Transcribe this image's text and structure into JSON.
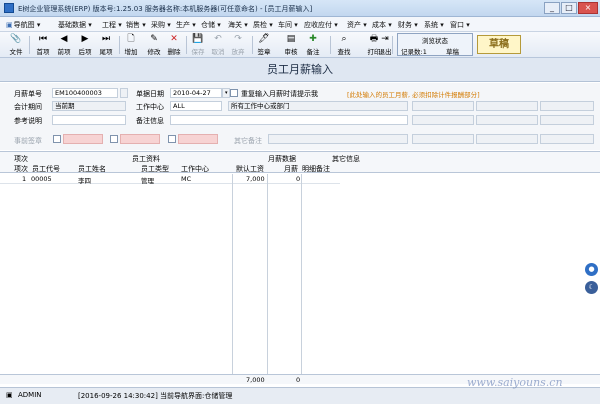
{
  "window": {
    "title": "E树企业管理系统(ERP) 版本号:1.25.03 服务器名称:本机服务器(可任意命名) - [员工月薪输入]",
    "controls": [
      "_",
      "□",
      "×"
    ]
  },
  "menu": [
    {
      "icon": "▣",
      "label": "导航图 ▾"
    },
    {
      "label": "基础数据 ▾"
    },
    {
      "label": "工程 ▾"
    },
    {
      "label": "销售 ▾"
    },
    {
      "label": "采购 ▾"
    },
    {
      "label": "生产 ▾"
    },
    {
      "label": "仓储 ▾"
    },
    {
      "label": "海关 ▾"
    },
    {
      "label": "质检 ▾"
    },
    {
      "label": "车间 ▾"
    },
    {
      "label": "应收应付 ▾"
    },
    {
      "label": "资产 ▾"
    },
    {
      "label": "成本 ▾"
    },
    {
      "label": "财务 ▾"
    },
    {
      "label": "系统 ▾"
    },
    {
      "label": "窗口 ▾"
    }
  ],
  "toolbar": {
    "file": "文件",
    "first": "首项",
    "prev": "前项",
    "next": "后项",
    "last": "尾项",
    "add": "增加",
    "edit": "修改",
    "delete": "删除",
    "save": "保存",
    "undo": "取消",
    "abandon": "放弃",
    "sign": "签章",
    "review": "审核",
    "note": "备注",
    "find": "查找",
    "print": "打印",
    "exit": "退出"
  },
  "browse_status": {
    "caption": "浏览状态",
    "record_count": "记录数:1",
    "state": "草稿"
  },
  "draft_stamp": "草稿",
  "doc_title": "员工月薪输入",
  "form": {
    "month_no_label": "月薪单号",
    "month_no": "EM100400003",
    "doc_date_label": "单据日期",
    "doc_date": "2010-04-27",
    "repeat_prompt_label": "重复输入月薪时请提示我",
    "hint": "[此处输入的员工月薪, 必须扣除计件报酬部分]",
    "period_label": "会计期间",
    "period": "当前期",
    "work_center_label": "工作中心",
    "work_center": "ALL",
    "work_center_name": "所有工作中心或部门",
    "ref_label": "参考说明",
    "note_label": "备注信息",
    "sign_label": "事前签章",
    "other_note_label": "其它备注"
  },
  "grid": {
    "group_headers": {
      "seq": "项次",
      "emp": "员工资料",
      "salary": "月薪数据",
      "other": "其它信息"
    },
    "columns": {
      "seq": "项次",
      "emp_code": "员工代号",
      "emp_name": "员工姓名",
      "emp_type": "员工类型",
      "work_center": "工作中心",
      "default_wage": "默认工资",
      "monthly": "月薪",
      "detail_note": "明细备注"
    },
    "rows": [
      {
        "seq": "1",
        "emp_code": "00005",
        "emp_name": "李四",
        "emp_type": "管理",
        "work_center": "MC",
        "default_wage": "7,000",
        "monthly": "0",
        "detail_note": ""
      }
    ],
    "totals": {
      "default_wage": "7,000",
      "monthly": "0"
    }
  },
  "status": {
    "user": "ADMIN",
    "message": "[2016-09-26 14:30:42] 当前导航界面:仓储管理"
  },
  "watermark": "www.saiyouns.cn"
}
